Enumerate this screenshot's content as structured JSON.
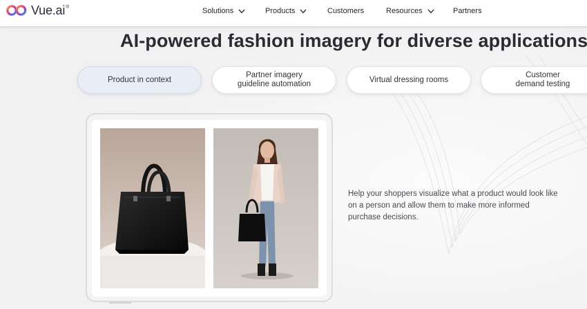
{
  "brand": {
    "name": "Vue.ai",
    "trademark": "®"
  },
  "nav": {
    "solutions": "Solutions",
    "products": "Products",
    "customers": "Customers",
    "resources": "Resources",
    "partners": "Partners"
  },
  "hero": {
    "title": "AI-powered fashion imagery for diverse applications",
    "tabs": [
      {
        "label": "Product in context",
        "active": true
      },
      {
        "label": "Partner imagery guideline automation",
        "active": false
      },
      {
        "label": "Virtual dressing rooms",
        "active": false
      },
      {
        "label": "Customer demand testing",
        "active": false
      }
    ],
    "description": "Help your shoppers visualize what a product would look like on a person and allow them to make more informed purchase decisions."
  },
  "colors": {
    "background": "#f1f1f2",
    "active_tab": "#e9edf5",
    "heading": "#2b2b33",
    "logo_gradient": [
      "#f0a93b",
      "#e4457a",
      "#7b4dd8",
      "#3aa0e8"
    ]
  }
}
